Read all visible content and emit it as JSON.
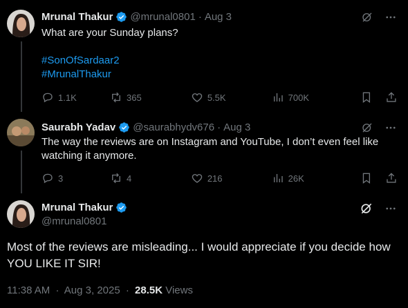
{
  "tweet1": {
    "name": "Mrunal Thakur",
    "handle": "@mrunal0801",
    "dot": "·",
    "date": "Aug 3",
    "text": "What are your Sunday plans?",
    "hashtags": [
      "#SonOfSardaar2",
      "#MrunalThakur"
    ],
    "replies": "1.1K",
    "reposts": "365",
    "likes": "5.5K",
    "views": "700K"
  },
  "tweet2": {
    "name": "Saurabh Yadav",
    "handle": "@saurabhydv676",
    "dot": "·",
    "date": "Aug 3",
    "text": "The way the reviews are on Instagram and YouTube, I don’t even feel like watching it anymore.",
    "replies": "3",
    "reposts": "4",
    "likes": "216",
    "views": "26K"
  },
  "tweet3": {
    "name": "Mrunal Thakur",
    "handle": "@mrunal0801",
    "text": "Most of the reviews are misleading...  I would appreciate if you decide how YOU LIKE IT SIR!",
    "time": "11:38 AM",
    "dot": "·",
    "date": "Aug 3, 2025",
    "meta_dot": "·",
    "views_count": "28.5K",
    "views_label": "Views"
  },
  "colors": {
    "background": "#000000",
    "text": "#e7e9ea",
    "muted": "#71767b",
    "link": "#1d9bf0",
    "verified": "#1d9bf0"
  },
  "icons": [
    "verified-badge-icon",
    "grok-icon",
    "more-icon",
    "reply-icon",
    "repost-icon",
    "like-icon",
    "views-icon",
    "bookmark-icon",
    "share-icon"
  ]
}
